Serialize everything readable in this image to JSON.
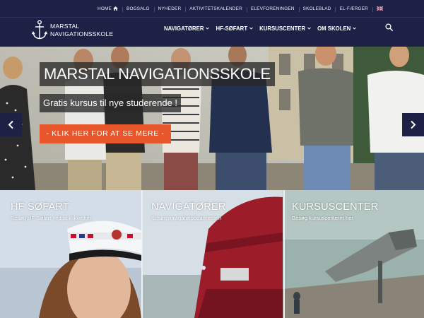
{
  "top_nav": {
    "items": [
      {
        "label": "HOME"
      },
      {
        "label": "BOGSALG"
      },
      {
        "label": "NYHEDER"
      },
      {
        "label": "AKTIVITETSKALENDER"
      },
      {
        "label": "ELEVFORENINGEN"
      },
      {
        "label": "SKOLEBLAD"
      },
      {
        "label": "EL-FÆRGER"
      }
    ],
    "language_flag": "uk-flag-icon"
  },
  "logo": {
    "line1": "MARSTAL",
    "line2": "NAVIGATIONSSKOLE",
    "icon": "anchor-icon"
  },
  "main_nav": {
    "items": [
      {
        "label": "NAVIGATØRER"
      },
      {
        "label": "HF-SØFART"
      },
      {
        "label": "KURSUSCENTER"
      },
      {
        "label": "OM SKOLEN"
      }
    ],
    "search_icon": "search-icon"
  },
  "hero": {
    "title": "MARSTAL NAVIGATIONSSKOLE",
    "subtitle": "Gratis kursus til nye studerende !",
    "cta_label": "- KLIK HER FOR AT SE MERE -"
  },
  "tiles": [
    {
      "title": "HF SØFART",
      "subtitle": "Besøg HF-Søfart ved at klikke her"
    },
    {
      "title": "NAVIGATØRER",
      "subtitle": "Besøg navigatøruddannelsen"
    },
    {
      "title": "KURSUSCENTER",
      "subtitle": "Besøg kursuscenteret her"
    }
  ],
  "colors": {
    "header_bg": "#1d2146",
    "cta_orange": "#e8572b",
    "white": "#ffffff"
  }
}
